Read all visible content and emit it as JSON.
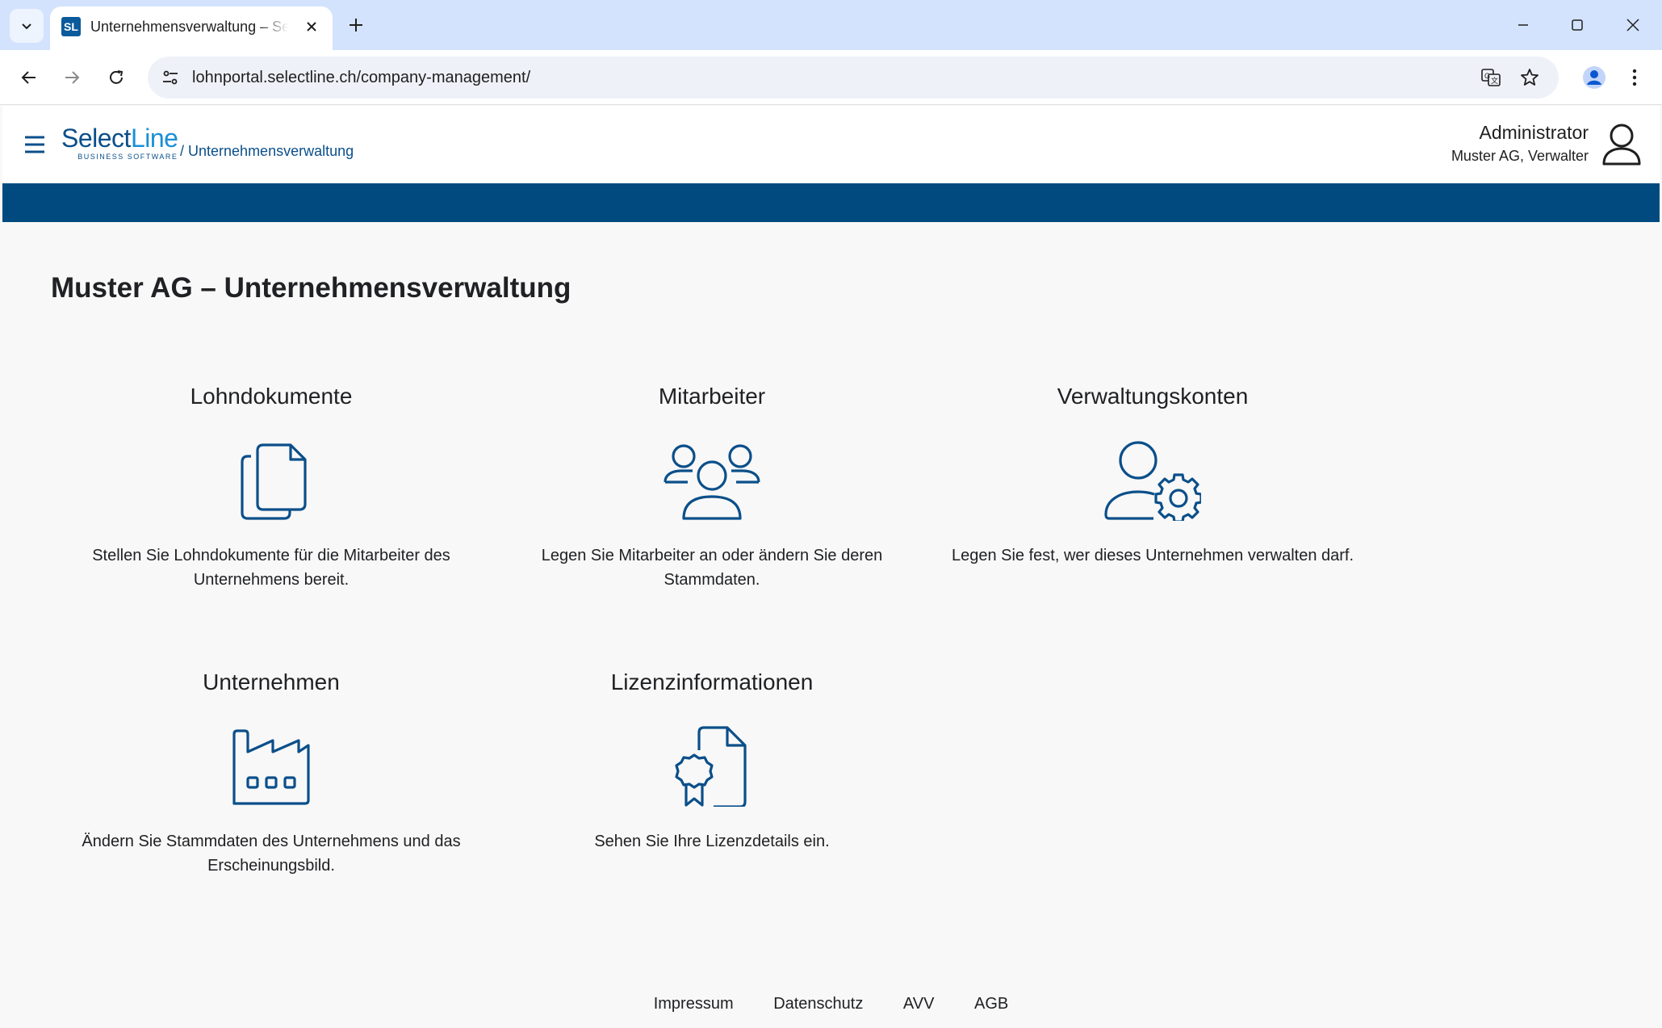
{
  "browser": {
    "tab_title": "Unternehmensverwaltung – SelectLine",
    "favicon_text": "SL",
    "url": "lohnportal.selectline.ch/company-management/"
  },
  "header": {
    "logo_main": "Select",
    "logo_accent": "Line",
    "logo_sub": "BUSINESS SOFTWARE",
    "breadcrumb_sep": "/ ",
    "breadcrumb": "Unternehmensverwaltung",
    "user_name": "Administrator",
    "user_role": "Muster AG, Verwalter"
  },
  "main": {
    "title": "Muster AG – Unternehmensverwaltung",
    "cards": [
      {
        "title": "Lohndokumente",
        "icon": "documents-icon",
        "desc": "Stellen Sie Lohndokumente für die Mitarbeiter des Unternehmens bereit."
      },
      {
        "title": "Mitarbeiter",
        "icon": "users-group-icon",
        "desc": "Legen Sie Mitarbeiter an oder ändern Sie deren Stammdaten."
      },
      {
        "title": "Verwaltungskonten",
        "icon": "user-settings-icon",
        "desc": "Legen Sie fest, wer dieses Unternehmen verwalten darf."
      },
      {
        "title": "Unternehmen",
        "icon": "factory-icon",
        "desc": "Ändern Sie Stammdaten des Unternehmens und das Erscheinungsbild."
      },
      {
        "title": "Lizenzinformationen",
        "icon": "certificate-icon",
        "desc": "Sehen Sie Ihre Lizenzdetails ein."
      }
    ]
  },
  "footer": {
    "links": [
      "Impressum",
      "Datenschutz",
      "AVV",
      "AGB"
    ]
  },
  "colors": {
    "brand_blue": "#004a80",
    "icon_blue": "#0b4f8a",
    "tabstrip": "#d3e3fd"
  }
}
